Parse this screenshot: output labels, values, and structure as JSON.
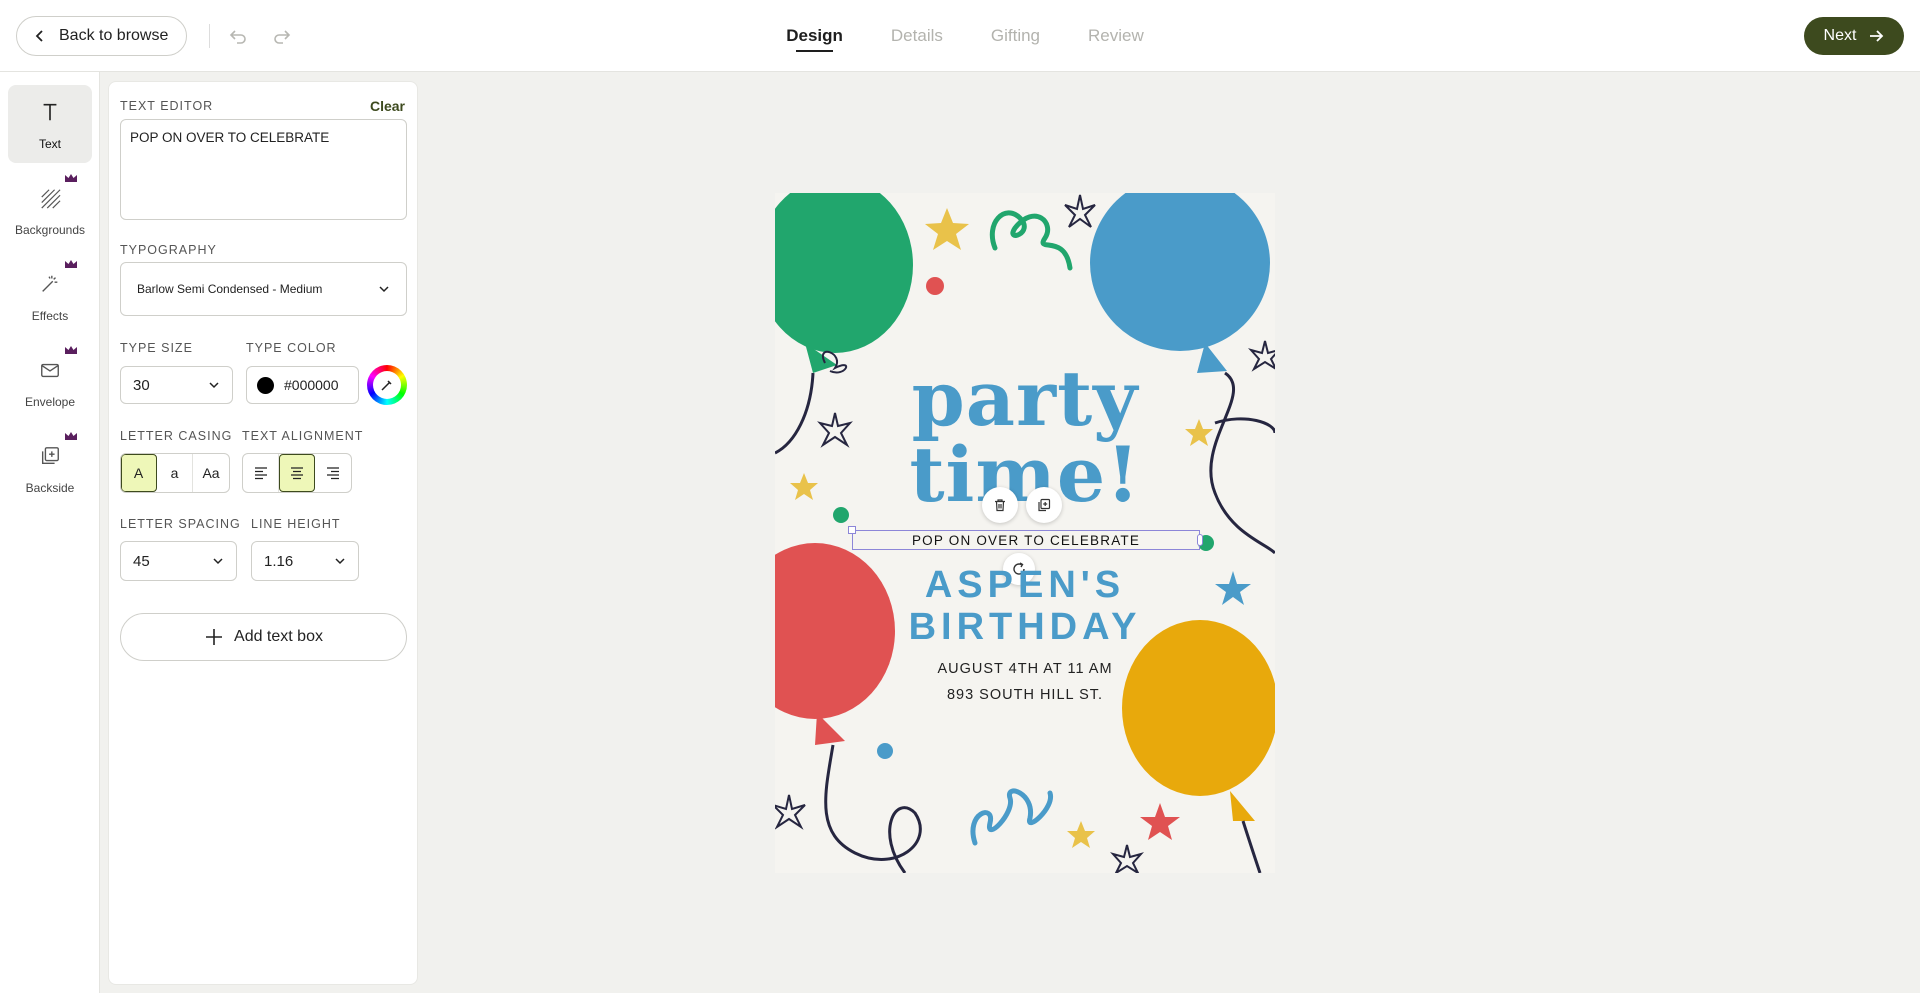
{
  "topbar": {
    "back_label": "Back to browse",
    "steps": [
      "Design",
      "Details",
      "Gifting",
      "Review"
    ],
    "active_step": "Design",
    "next_label": "Next",
    "accent": "#3d4a1e"
  },
  "rail": {
    "items": [
      {
        "label": "Text",
        "icon": "text-icon",
        "active": true
      },
      {
        "label": "Backgrounds",
        "icon": "backgrounds-icon",
        "premium": true
      },
      {
        "label": "Effects",
        "icon": "effects-wand-icon",
        "premium": true
      },
      {
        "label": "Envelope",
        "icon": "envelope-icon",
        "premium": true
      },
      {
        "label": "Backside",
        "icon": "backside-icon",
        "premium": true
      }
    ]
  },
  "panel": {
    "text_editor_label": "TEXT EDITOR",
    "clear_label": "Clear",
    "text_value": "POP ON OVER TO CELEBRATE",
    "typography_label": "TYPOGRAPHY",
    "font_value": "Barlow Semi Condensed - Medium",
    "type_size_label": "TYPE SIZE",
    "type_size_value": "30",
    "type_color_label": "TYPE COLOR",
    "type_color_value": "#000000",
    "letter_casing_label": "LETTER CASING",
    "casing_options": [
      "A",
      "a",
      "Aa"
    ],
    "text_alignment_label": "TEXT ALIGNMENT",
    "letter_spacing_label": "LETTER SPACING",
    "letter_spacing_value": "45",
    "line_height_label": "LINE HEIGHT",
    "line_height_value": "1.16",
    "add_text_box_label": "Add text box"
  },
  "card": {
    "headline_line1": "party",
    "headline_line2": "time!",
    "selected_text": "POP ON OVER TO CELEBRATE",
    "name_line1": "ASPEN'S",
    "name_line2": "BIRTHDAY",
    "detail_line1": "AUGUST 4TH AT 11 AM",
    "detail_line2": "893 SOUTH HILL ST.",
    "colors": {
      "green": "#21a66d",
      "blue": "#4a9bc9",
      "red": "#e05252",
      "yellow": "#e8a90c",
      "star": "#e9c24a"
    }
  }
}
